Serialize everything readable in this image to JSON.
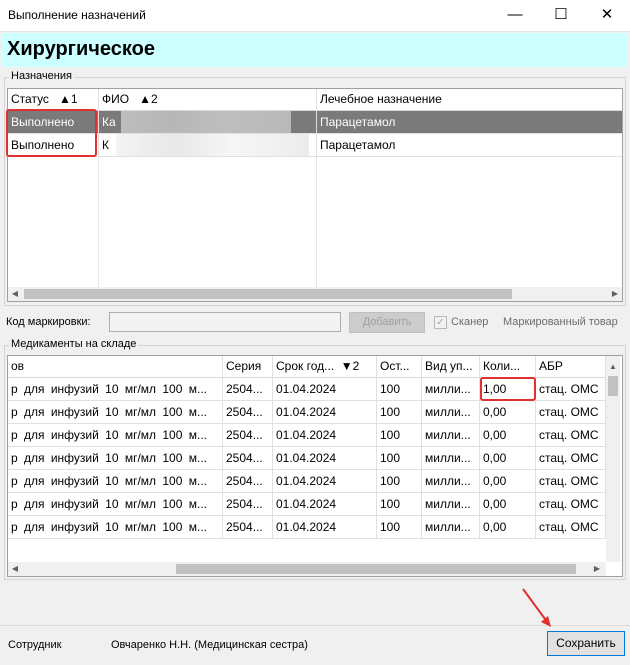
{
  "window": {
    "title": "Выполнение назначений",
    "minimize": "—",
    "maximize": "☐",
    "close": "✕"
  },
  "header": {
    "department": "Хирургическое"
  },
  "appointments": {
    "group_label": "Назначения",
    "columns": [
      {
        "label": "Статус",
        "sort": "▲1"
      },
      {
        "label": "ФИО",
        "sort": "▲2"
      },
      {
        "label": "Лечебное назначение",
        "sort": ""
      }
    ],
    "rows": [
      {
        "status": "Выполнено",
        "fio": "Ка",
        "treatment": "Парацетамол"
      },
      {
        "status": "Выполнено",
        "fio": "К",
        "treatment": "Парацетамол"
      }
    ]
  },
  "marking": {
    "label": "Код маркировки:",
    "value": "",
    "add_button": "Добавить",
    "scanner_label": "Сканер",
    "marked_goods_label": "Маркированный товар"
  },
  "stock": {
    "group_label": "Медикаменты на складе",
    "columns": [
      {
        "label": "ов",
        "sort": ""
      },
      {
        "label": "Серия",
        "sort": ""
      },
      {
        "label": "Срок год...",
        "sort": "▼2"
      },
      {
        "label": "Ост...",
        "sort": ""
      },
      {
        "label": "Вид уп...",
        "sort": ""
      },
      {
        "label": "Коли...",
        "sort": ""
      },
      {
        "label": "АБР",
        "sort": ""
      }
    ],
    "rows": [
      {
        "name": "р для инфузий 10 мг/мл 100 м...",
        "series": "2504...",
        "expiry": "01.04.2024",
        "rest": "100",
        "pack": "милли...",
        "qty": "1,00",
        "abr": "стац. ОМС"
      },
      {
        "name": "р для инфузий 10 мг/мл 100 м...",
        "series": "2504...",
        "expiry": "01.04.2024",
        "rest": "100",
        "pack": "милли...",
        "qty": "0,00",
        "abr": "стац. ОМС"
      },
      {
        "name": "р для инфузий 10 мг/мл 100 м...",
        "series": "2504...",
        "expiry": "01.04.2024",
        "rest": "100",
        "pack": "милли...",
        "qty": "0,00",
        "abr": "стац. ОМС"
      },
      {
        "name": "р для инфузий 10 мг/мл 100 м...",
        "series": "2504...",
        "expiry": "01.04.2024",
        "rest": "100",
        "pack": "милли...",
        "qty": "0,00",
        "abr": "стац. ОМС"
      },
      {
        "name": "р для инфузий 10 мг/мл 100 м...",
        "series": "2504...",
        "expiry": "01.04.2024",
        "rest": "100",
        "pack": "милли...",
        "qty": "0,00",
        "abr": "стац. ОМС"
      },
      {
        "name": "р для инфузий 10 мг/мл 100 м...",
        "series": "2504...",
        "expiry": "01.04.2024",
        "rest": "100",
        "pack": "милли...",
        "qty": "0,00",
        "abr": "стац. ОМС"
      },
      {
        "name": "р для инфузий 10 мг/мл 100 м...",
        "series": "2504...",
        "expiry": "01.04.2024",
        "rest": "100",
        "pack": "милли...",
        "qty": "0,00",
        "abr": "стац. ОМС"
      }
    ]
  },
  "footer": {
    "employee_label": "Сотрудник",
    "employee_name": "Овчаренко Н.Н. (Медицинская сестра)",
    "save_button": "Сохранить"
  },
  "colors": {
    "highlight": "#e03030",
    "header_band": "#ccffff",
    "selected_row": "#7a7a7a"
  }
}
